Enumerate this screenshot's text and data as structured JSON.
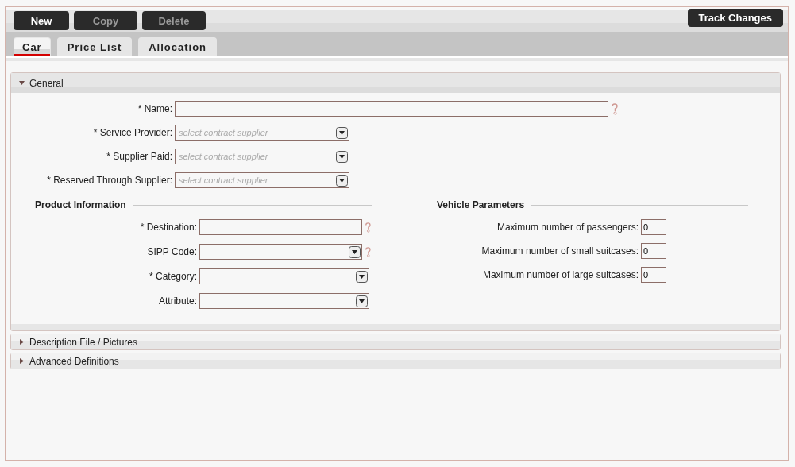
{
  "toolbar": {
    "buttons": [
      {
        "label": "New",
        "disabled": false
      },
      {
        "label": "Copy",
        "disabled": true
      },
      {
        "label": "Delete",
        "disabled": true
      }
    ],
    "track_button": "Track Changes"
  },
  "tabs": [
    {
      "label": "Car",
      "selected": true
    },
    {
      "label": "Price List",
      "selected": false
    },
    {
      "label": "Allocation",
      "selected": false
    }
  ],
  "sections": [
    {
      "title": "General",
      "expanded": true,
      "fields": [
        {
          "label": "* Name:",
          "kind": "text",
          "wide": true,
          "help": true
        },
        {
          "label": "* Service Provider:",
          "kind": "select",
          "placeholder": "select contract supplier",
          "help": false
        },
        {
          "label": "* Supplier Paid:",
          "kind": "select",
          "placeholder": "select contract supplier",
          "help": false
        },
        {
          "label": "* Reserved Through Supplier:",
          "kind": "select",
          "placeholder": "select contract supplier",
          "help": false
        }
      ],
      "groups": [
        {
          "title": "Product Information",
          "fields": [
            {
              "label": "* Destination:",
              "kind": "text",
              "help": true
            },
            {
              "label": "SIPP Code:",
              "kind": "select",
              "help": true
            },
            {
              "label": "* Category:",
              "kind": "select",
              "help": false
            },
            {
              "label": "Attribute:",
              "kind": "select",
              "help": false
            }
          ]
        },
        {
          "title": "Vehicle Parameters",
          "fields": [
            {
              "label": "Maximum number of passengers:",
              "kind": "number",
              "value": "0"
            },
            {
              "label": "Maximum number of small suitcases:",
              "kind": "number",
              "value": "0"
            },
            {
              "label": "Maximum number of large suitcases:",
              "kind": "number",
              "value": "0"
            }
          ]
        }
      ]
    },
    {
      "title": "Description File / Pictures",
      "expanded": false
    },
    {
      "title": "Advanced Definitions",
      "expanded": false
    }
  ]
}
